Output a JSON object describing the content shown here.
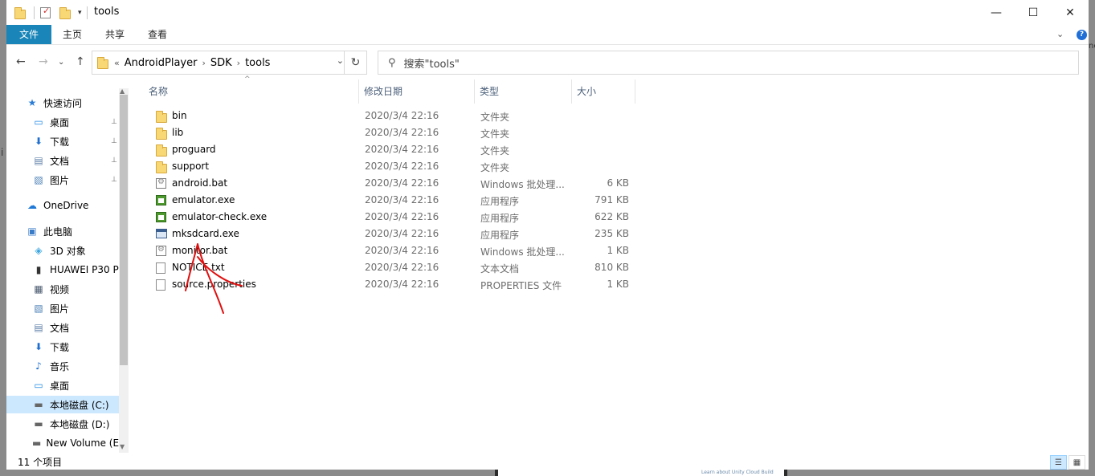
{
  "window": {
    "title": "tools",
    "controls": {
      "minimize": "—",
      "maximize": "☐",
      "close": "✕"
    }
  },
  "ribbon": {
    "tabs": [
      "文件",
      "主页",
      "共享",
      "查看"
    ],
    "expand": "⌄",
    "help": "?"
  },
  "navigation": {
    "back": "←",
    "forward": "→",
    "recent": "⌄",
    "up": "↑",
    "prefix": "«",
    "breadcrumbs": [
      "AndroidPlayer",
      "SDK",
      "tools"
    ],
    "search_placeholder": "搜索\"tools\""
  },
  "sidebar": {
    "items": [
      {
        "label": "快速访问",
        "icon": "★",
        "icon_color": "#2b7cd3",
        "indent": 1,
        "pinned": false
      },
      {
        "label": "桌面",
        "icon": "▭",
        "icon_color": "#1e88e5",
        "indent": 2,
        "pinned": true
      },
      {
        "label": "下载",
        "icon": "⬇",
        "icon_color": "#1e6fd0",
        "indent": 2,
        "pinned": true
      },
      {
        "label": "文档",
        "icon": "▤",
        "icon_color": "#5d7fa8",
        "indent": 2,
        "pinned": true
      },
      {
        "label": "图片",
        "icon": "▧",
        "icon_color": "#4a7fb5",
        "indent": 2,
        "pinned": true
      },
      {
        "label": "OneDrive",
        "icon": "☁",
        "icon_color": "#1e78d6",
        "indent": 1,
        "pinned": false
      },
      {
        "label": "此电脑",
        "icon": "▣",
        "icon_color": "#3a7bc8",
        "indent": 1,
        "pinned": false
      },
      {
        "label": "3D 对象",
        "icon": "◈",
        "icon_color": "#3fa7e0",
        "indent": 2,
        "pinned": false
      },
      {
        "label": "HUAWEI P30 P",
        "icon": "▮",
        "icon_color": "#333333",
        "indent": 2,
        "pinned": false
      },
      {
        "label": "视频",
        "icon": "▦",
        "icon_color": "#4a5a70",
        "indent": 2,
        "pinned": false
      },
      {
        "label": "图片",
        "icon": "▧",
        "icon_color": "#4a7fb5",
        "indent": 2,
        "pinned": false
      },
      {
        "label": "文档",
        "icon": "▤",
        "icon_color": "#5d7fa8",
        "indent": 2,
        "pinned": false
      },
      {
        "label": "下载",
        "icon": "⬇",
        "icon_color": "#1e6fd0",
        "indent": 2,
        "pinned": false
      },
      {
        "label": "音乐",
        "icon": "♪",
        "icon_color": "#1e6fd0",
        "indent": 2,
        "pinned": false
      },
      {
        "label": "桌面",
        "icon": "▭",
        "icon_color": "#1e88e5",
        "indent": 2,
        "pinned": false
      },
      {
        "label": "本地磁盘 (C:)",
        "icon": "▬",
        "icon_color": "#666666",
        "indent": 2,
        "pinned": false,
        "selected": true
      },
      {
        "label": "本地磁盘 (D:)",
        "icon": "▬",
        "icon_color": "#666666",
        "indent": 2,
        "pinned": false
      },
      {
        "label": "New Volume (E",
        "icon": "▬",
        "icon_color": "#666666",
        "indent": 2,
        "pinned": false
      }
    ],
    "pin_glyph": "📌"
  },
  "columns": [
    "名称",
    "修改日期",
    "类型",
    "大小"
  ],
  "files": [
    {
      "name": "bin",
      "date": "2020/3/4 22:16",
      "type": "文件夹",
      "size": "",
      "kind": "folder"
    },
    {
      "name": "lib",
      "date": "2020/3/4 22:16",
      "type": "文件夹",
      "size": "",
      "kind": "folder"
    },
    {
      "name": "proguard",
      "date": "2020/3/4 22:16",
      "type": "文件夹",
      "size": "",
      "kind": "folder"
    },
    {
      "name": "support",
      "date": "2020/3/4 22:16",
      "type": "文件夹",
      "size": "",
      "kind": "folder"
    },
    {
      "name": "android.bat",
      "date": "2020/3/4 22:16",
      "type": "Windows 批处理...",
      "size": "6 KB",
      "kind": "bat"
    },
    {
      "name": "emulator.exe",
      "date": "2020/3/4 22:16",
      "type": "应用程序",
      "size": "791 KB",
      "kind": "exe"
    },
    {
      "name": "emulator-check.exe",
      "date": "2020/3/4 22:16",
      "type": "应用程序",
      "size": "622 KB",
      "kind": "exe"
    },
    {
      "name": "mksdcard.exe",
      "date": "2020/3/4 22:16",
      "type": "应用程序",
      "size": "235 KB",
      "kind": "exe2"
    },
    {
      "name": "monitor.bat",
      "date": "2020/3/4 22:16",
      "type": "Windows 批处理...",
      "size": "1 KB",
      "kind": "bat"
    },
    {
      "name": "NOTICE.txt",
      "date": "2020/3/4 22:16",
      "type": "文本文档",
      "size": "810 KB",
      "kind": "file"
    },
    {
      "name": "source.properties",
      "date": "2020/3/4 22:16",
      "type": "PROPERTIES 文件",
      "size": "1 KB",
      "kind": "file"
    }
  ],
  "status": {
    "count": "11 个项目",
    "details_view": "☰",
    "icons_view": "▦"
  },
  "background": {
    "caption": "Learn about Unity Cloud Build",
    "left_edge": "i",
    "right_edge": "ne"
  },
  "colors": {
    "file_tab": "#1a85b8",
    "selection": "#cce8ff",
    "annotation": "#e01010"
  }
}
